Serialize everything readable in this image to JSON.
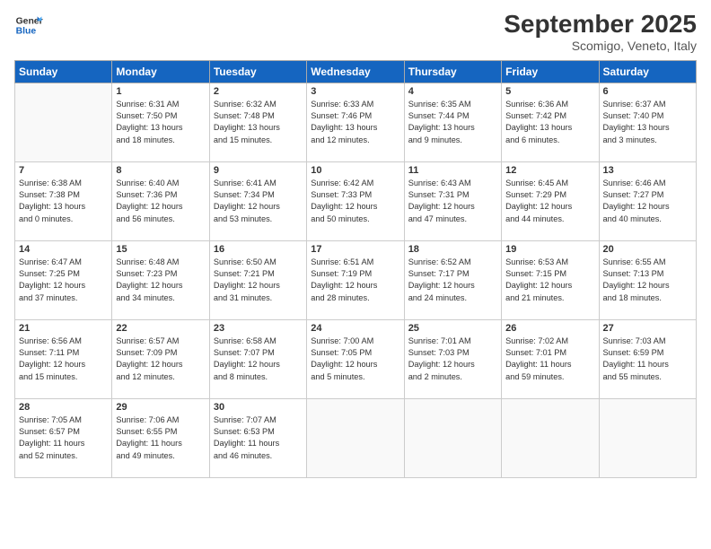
{
  "logo": {
    "line1": "General",
    "line2": "Blue"
  },
  "title": "September 2025",
  "location": "Scomigo, Veneto, Italy",
  "days_of_week": [
    "Sunday",
    "Monday",
    "Tuesday",
    "Wednesday",
    "Thursday",
    "Friday",
    "Saturday"
  ],
  "weeks": [
    [
      {
        "day": "",
        "info": ""
      },
      {
        "day": "1",
        "info": "Sunrise: 6:31 AM\nSunset: 7:50 PM\nDaylight: 13 hours\nand 18 minutes."
      },
      {
        "day": "2",
        "info": "Sunrise: 6:32 AM\nSunset: 7:48 PM\nDaylight: 13 hours\nand 15 minutes."
      },
      {
        "day": "3",
        "info": "Sunrise: 6:33 AM\nSunset: 7:46 PM\nDaylight: 13 hours\nand 12 minutes."
      },
      {
        "day": "4",
        "info": "Sunrise: 6:35 AM\nSunset: 7:44 PM\nDaylight: 13 hours\nand 9 minutes."
      },
      {
        "day": "5",
        "info": "Sunrise: 6:36 AM\nSunset: 7:42 PM\nDaylight: 13 hours\nand 6 minutes."
      },
      {
        "day": "6",
        "info": "Sunrise: 6:37 AM\nSunset: 7:40 PM\nDaylight: 13 hours\nand 3 minutes."
      }
    ],
    [
      {
        "day": "7",
        "info": "Sunrise: 6:38 AM\nSunset: 7:38 PM\nDaylight: 13 hours\nand 0 minutes."
      },
      {
        "day": "8",
        "info": "Sunrise: 6:40 AM\nSunset: 7:36 PM\nDaylight: 12 hours\nand 56 minutes."
      },
      {
        "day": "9",
        "info": "Sunrise: 6:41 AM\nSunset: 7:34 PM\nDaylight: 12 hours\nand 53 minutes."
      },
      {
        "day": "10",
        "info": "Sunrise: 6:42 AM\nSunset: 7:33 PM\nDaylight: 12 hours\nand 50 minutes."
      },
      {
        "day": "11",
        "info": "Sunrise: 6:43 AM\nSunset: 7:31 PM\nDaylight: 12 hours\nand 47 minutes."
      },
      {
        "day": "12",
        "info": "Sunrise: 6:45 AM\nSunset: 7:29 PM\nDaylight: 12 hours\nand 44 minutes."
      },
      {
        "day": "13",
        "info": "Sunrise: 6:46 AM\nSunset: 7:27 PM\nDaylight: 12 hours\nand 40 minutes."
      }
    ],
    [
      {
        "day": "14",
        "info": "Sunrise: 6:47 AM\nSunset: 7:25 PM\nDaylight: 12 hours\nand 37 minutes."
      },
      {
        "day": "15",
        "info": "Sunrise: 6:48 AM\nSunset: 7:23 PM\nDaylight: 12 hours\nand 34 minutes."
      },
      {
        "day": "16",
        "info": "Sunrise: 6:50 AM\nSunset: 7:21 PM\nDaylight: 12 hours\nand 31 minutes."
      },
      {
        "day": "17",
        "info": "Sunrise: 6:51 AM\nSunset: 7:19 PM\nDaylight: 12 hours\nand 28 minutes."
      },
      {
        "day": "18",
        "info": "Sunrise: 6:52 AM\nSunset: 7:17 PM\nDaylight: 12 hours\nand 24 minutes."
      },
      {
        "day": "19",
        "info": "Sunrise: 6:53 AM\nSunset: 7:15 PM\nDaylight: 12 hours\nand 21 minutes."
      },
      {
        "day": "20",
        "info": "Sunrise: 6:55 AM\nSunset: 7:13 PM\nDaylight: 12 hours\nand 18 minutes."
      }
    ],
    [
      {
        "day": "21",
        "info": "Sunrise: 6:56 AM\nSunset: 7:11 PM\nDaylight: 12 hours\nand 15 minutes."
      },
      {
        "day": "22",
        "info": "Sunrise: 6:57 AM\nSunset: 7:09 PM\nDaylight: 12 hours\nand 12 minutes."
      },
      {
        "day": "23",
        "info": "Sunrise: 6:58 AM\nSunset: 7:07 PM\nDaylight: 12 hours\nand 8 minutes."
      },
      {
        "day": "24",
        "info": "Sunrise: 7:00 AM\nSunset: 7:05 PM\nDaylight: 12 hours\nand 5 minutes."
      },
      {
        "day": "25",
        "info": "Sunrise: 7:01 AM\nSunset: 7:03 PM\nDaylight: 12 hours\nand 2 minutes."
      },
      {
        "day": "26",
        "info": "Sunrise: 7:02 AM\nSunset: 7:01 PM\nDaylight: 11 hours\nand 59 minutes."
      },
      {
        "day": "27",
        "info": "Sunrise: 7:03 AM\nSunset: 6:59 PM\nDaylight: 11 hours\nand 55 minutes."
      }
    ],
    [
      {
        "day": "28",
        "info": "Sunrise: 7:05 AM\nSunset: 6:57 PM\nDaylight: 11 hours\nand 52 minutes."
      },
      {
        "day": "29",
        "info": "Sunrise: 7:06 AM\nSunset: 6:55 PM\nDaylight: 11 hours\nand 49 minutes."
      },
      {
        "day": "30",
        "info": "Sunrise: 7:07 AM\nSunset: 6:53 PM\nDaylight: 11 hours\nand 46 minutes."
      },
      {
        "day": "",
        "info": ""
      },
      {
        "day": "",
        "info": ""
      },
      {
        "day": "",
        "info": ""
      },
      {
        "day": "",
        "info": ""
      }
    ]
  ]
}
